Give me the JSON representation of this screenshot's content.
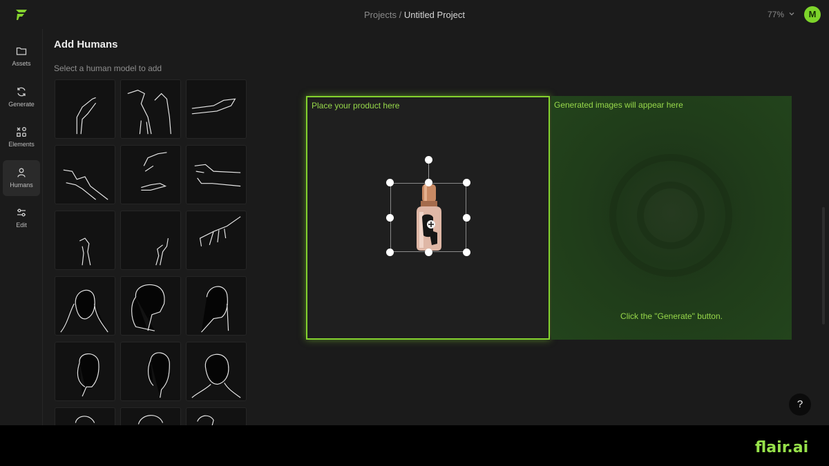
{
  "header": {
    "breadcrumb_root": "Projects",
    "breadcrumb_sep": " / ",
    "project_name": "Untitled Project",
    "zoom": "77%",
    "avatar_initial": "M"
  },
  "sidebar": {
    "items": [
      {
        "label": "Assets",
        "icon": "folder-icon"
      },
      {
        "label": "Generate",
        "icon": "refresh-icon"
      },
      {
        "label": "Elements",
        "icon": "elements-icon"
      },
      {
        "label": "Humans",
        "icon": "person-icon",
        "active": true
      },
      {
        "label": "Edit",
        "icon": "sliders-icon"
      }
    ]
  },
  "panel": {
    "title": "Add Humans",
    "subtitle": "Select a human model to add",
    "models": [
      {
        "name": "hand-raised"
      },
      {
        "name": "hands-reaching"
      },
      {
        "name": "hand-flat"
      },
      {
        "name": "hand-pinch"
      },
      {
        "name": "hands-two"
      },
      {
        "name": "hand-point"
      },
      {
        "name": "hand-small-left"
      },
      {
        "name": "hand-small-right"
      },
      {
        "name": "hand-spread"
      },
      {
        "name": "face-front"
      },
      {
        "name": "face-profile-up"
      },
      {
        "name": "face-side"
      },
      {
        "name": "head-front"
      },
      {
        "name": "head-turned"
      },
      {
        "name": "head-bust"
      },
      {
        "name": "head-partial-1"
      },
      {
        "name": "head-partial-2"
      },
      {
        "name": "head-partial-3"
      }
    ]
  },
  "canvas": {
    "product_label": "Place your product here",
    "generated_label": "Generated images will appear here",
    "generate_hint": "Click the \"Generate\" button.",
    "accent_color": "#84d22e"
  },
  "help": {
    "label": "?"
  },
  "brand": {
    "text": "flair.ai"
  }
}
